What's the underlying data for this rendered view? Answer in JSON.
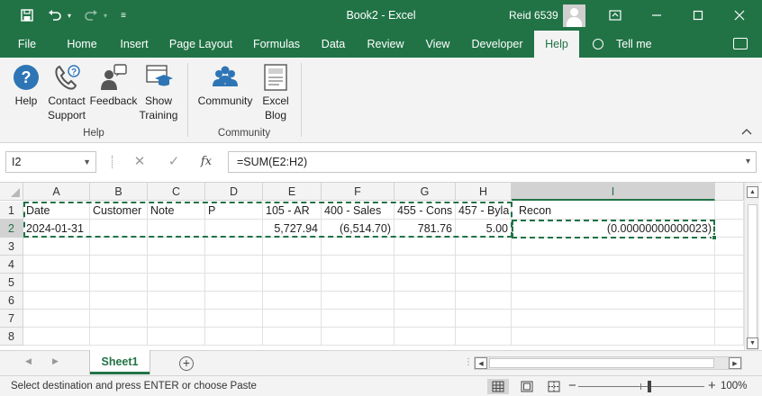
{
  "window": {
    "title": "Book2  -  Excel",
    "user": "Reid 6539"
  },
  "ribbon_tabs": [
    "File",
    "Home",
    "Insert",
    "Page Layout",
    "Formulas",
    "Data",
    "Review",
    "View",
    "Developer",
    "Help"
  ],
  "active_tab": "Help",
  "tell_me": "Tell me",
  "ribbon": {
    "help_group": {
      "label": "Help",
      "buttons": [
        {
          "label": "Help",
          "icon": "question-icon"
        },
        {
          "label": "Contact Support",
          "line1": "Contact",
          "line2": "Support",
          "icon": "phone-question-icon"
        },
        {
          "label": "Feedback",
          "icon": "person-feedback-icon"
        },
        {
          "label": "Show Training",
          "line1": "Show",
          "line2": "Training",
          "icon": "training-icon"
        }
      ]
    },
    "community_group": {
      "label": "Community",
      "buttons": [
        {
          "label": "Community",
          "icon": "people-icon"
        },
        {
          "label": "Excel Blog",
          "line1": "Excel",
          "line2": "Blog",
          "icon": "blog-icon"
        }
      ]
    }
  },
  "formula_bar": {
    "name_box": "I2",
    "formula": "=SUM(E2:H2)"
  },
  "grid": {
    "columns": [
      "A",
      "B",
      "C",
      "D",
      "E",
      "F",
      "G",
      "H",
      "I"
    ],
    "selected_column": "I",
    "row_numbers": [
      "1",
      "2",
      "3",
      "4",
      "5",
      "6",
      "7",
      "8"
    ],
    "selected_row": "2",
    "rows": [
      [
        "Date",
        "Customer",
        "Note",
        "P",
        "105 - AR",
        "400 - Sales",
        "455 - Cons",
        "457 - Byla",
        "Recon"
      ],
      [
        "2024-01-31",
        "",
        "",
        "",
        "5,727.94",
        "(6,514.70)",
        "781.76",
        "5.00",
        "(0.00000000000023)"
      ]
    ]
  },
  "sheets": [
    "Sheet1"
  ],
  "active_sheet": "Sheet1",
  "status": {
    "message": "Select destination and press ENTER or choose Paste",
    "zoom": "100%"
  },
  "colors": {
    "excel_green": "#217346",
    "ribbon_bg": "#f3f3f3",
    "help_blue": "#2e75b6"
  }
}
